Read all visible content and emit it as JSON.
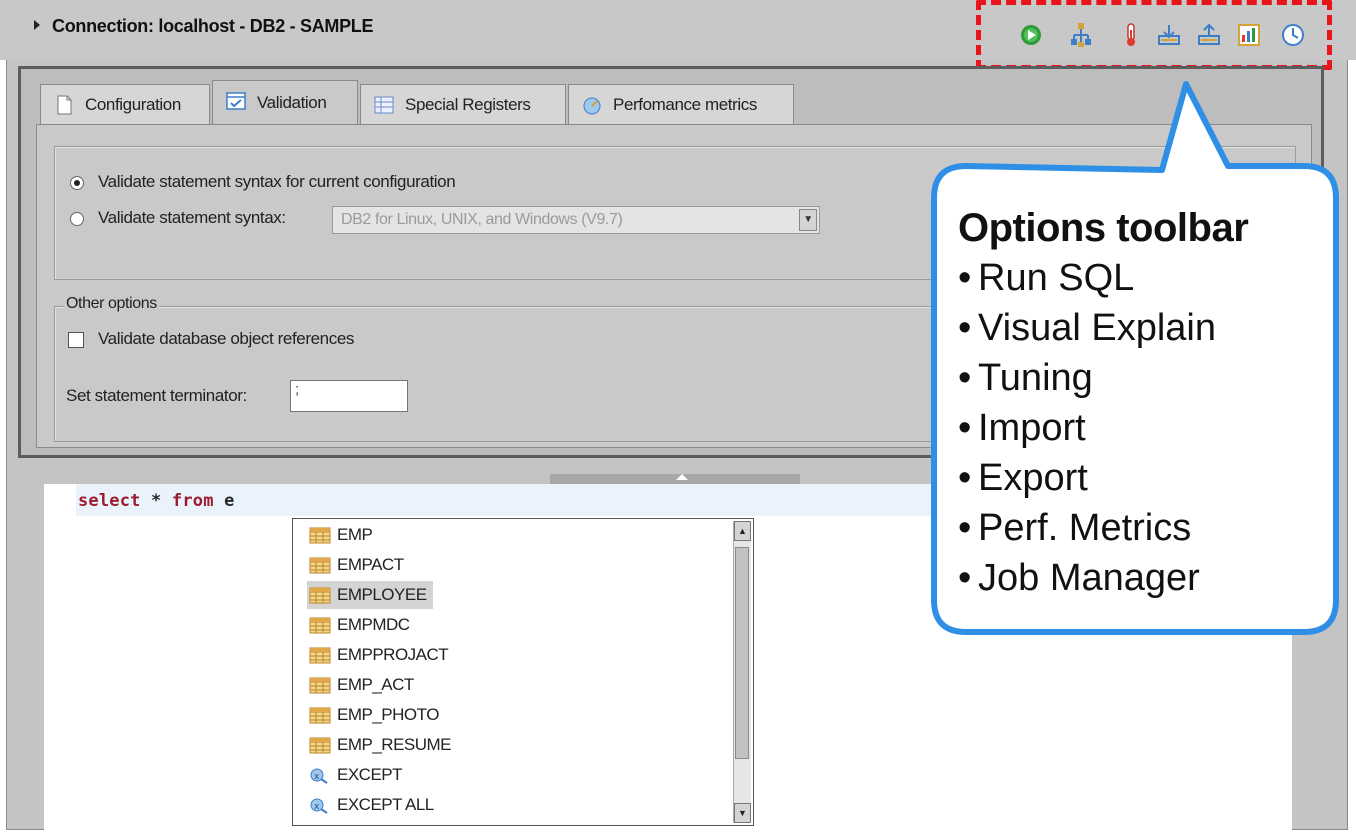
{
  "connection": {
    "title": "Connection: localhost - DB2 - SAMPLE"
  },
  "toolbar": {
    "icons": [
      "run-sql-icon",
      "visual-explain-icon",
      "tuning-icon",
      "import-icon",
      "export-icon",
      "perf-metrics-icon",
      "job-manager-icon"
    ],
    "highlight_color": "#e8141a"
  },
  "tabs": [
    {
      "label": "Configuration",
      "icon": "configuration-icon"
    },
    {
      "label": "Validation",
      "icon": "validation-icon",
      "active": true
    },
    {
      "label": "Special Registers",
      "icon": "special-registers-icon"
    },
    {
      "label": "Perfomance metrics",
      "icon": "performance-metrics-icon"
    }
  ],
  "validation": {
    "radio_current": "Validate statement syntax for current configuration",
    "radio_syntax": "Validate statement syntax:",
    "syntax_select": "DB2 for Linux, UNIX, and Windows (V9.7)",
    "selected": "current"
  },
  "other_options": {
    "title": "Other options",
    "check_label": "Validate database object references",
    "checked": false,
    "terminator_label": "Set statement terminator:",
    "terminator_value": ";"
  },
  "editor": {
    "keyword_select": "select",
    "star": "*",
    "keyword_from": "from",
    "partial": "e"
  },
  "autocomplete": {
    "items": [
      {
        "label": "EMP",
        "icon": "table-icon"
      },
      {
        "label": "EMPACT",
        "icon": "table-icon"
      },
      {
        "label": "EMPLOYEE",
        "icon": "table-icon",
        "selected": true
      },
      {
        "label": "EMPMDC",
        "icon": "table-icon"
      },
      {
        "label": "EMPPROJACT",
        "icon": "table-icon"
      },
      {
        "label": "EMP_ACT",
        "icon": "table-icon"
      },
      {
        "label": "EMP_PHOTO",
        "icon": "table-icon"
      },
      {
        "label": "EMP_RESUME",
        "icon": "table-icon"
      },
      {
        "label": "EXCEPT",
        "icon": "keyword-icon"
      },
      {
        "label": "EXCEPT ALL",
        "icon": "keyword-icon"
      }
    ]
  },
  "callout": {
    "title": "Options toolbar",
    "items": [
      "Run SQL",
      "Visual Explain",
      "Tuning",
      "Import",
      "Export",
      "Perf. Metrics",
      "Job Manager"
    ],
    "border_color": "#2f8fe6"
  }
}
